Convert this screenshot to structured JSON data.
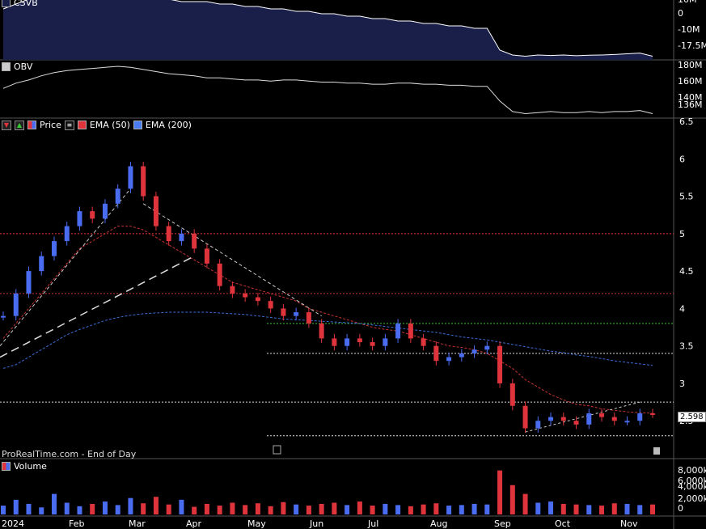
{
  "panels": {
    "csvb_label": "CSVB",
    "obv_label": "OBV",
    "price_label": "Price",
    "ema50_label": "EMA (50)",
    "ema200_label": "EMA (200)",
    "volume_label": "Volume"
  },
  "footer": "ProRealTime.com - End of Day",
  "last_price": "2.598",
  "axes": {
    "csvb_ticks": [
      "10M",
      "0",
      "-10M",
      "-17.5M"
    ],
    "obv_ticks": [
      "180M",
      "160M",
      "140M",
      "136M"
    ],
    "price_ticks": [
      "6.5",
      "6",
      "5.5",
      "5",
      "4.5",
      "4",
      "3.5",
      "3",
      "2.5"
    ],
    "volume_ticks": [
      "8,000k",
      "6,000k",
      "4,000k",
      "2,000k",
      "0"
    ],
    "x_ticks": [
      "2024",
      "Feb",
      "Mar",
      "Apr",
      "May",
      "Jun",
      "Jul",
      "Aug",
      "Sep",
      "Oct",
      "Nov"
    ]
  },
  "colors": {
    "up": "#4a6cf0",
    "down": "#e0343c",
    "ema50": "#c83232",
    "ema200": "#3c6cd8",
    "csvb_fill": "#1a1f4a"
  },
  "chart_data": {
    "type": "line",
    "x_ticks": [
      "2024",
      "Feb",
      "Mar",
      "Apr",
      "May",
      "Jun",
      "Jul",
      "Aug",
      "Sep",
      "Oct",
      "Nov"
    ],
    "price_ylim": [
      2.2,
      6.5
    ],
    "price": [
      3.9,
      4.2,
      4.5,
      4.7,
      4.9,
      5.1,
      5.3,
      5.2,
      5.4,
      5.6,
      5.9,
      5.5,
      5.1,
      4.9,
      5.0,
      4.8,
      4.6,
      4.3,
      4.2,
      4.15,
      4.1,
      4.0,
      3.9,
      3.95,
      3.8,
      3.6,
      3.5,
      3.6,
      3.55,
      3.5,
      3.6,
      3.8,
      3.6,
      3.5,
      3.3,
      3.35,
      3.4,
      3.45,
      3.5,
      3.0,
      2.7,
      2.4,
      2.5,
      2.55,
      2.5,
      2.45,
      2.6,
      2.55,
      2.5,
      2.5,
      2.6,
      2.598
    ],
    "ema50": [
      3.6,
      3.8,
      4.0,
      4.2,
      4.4,
      4.6,
      4.8,
      4.9,
      5.0,
      5.1,
      5.1,
      5.05,
      4.95,
      4.85,
      4.75,
      4.65,
      4.55,
      4.45,
      4.35,
      4.3,
      4.25,
      4.2,
      4.15,
      4.1,
      4.0,
      3.95,
      3.9,
      3.85,
      3.8,
      3.75,
      3.72,
      3.7,
      3.65,
      3.6,
      3.55,
      3.5,
      3.48,
      3.45,
      3.4,
      3.3,
      3.2,
      3.05,
      2.95,
      2.85,
      2.78,
      2.72,
      2.7,
      2.66,
      2.64,
      2.62,
      2.61,
      2.6
    ],
    "ema200": [
      3.2,
      3.25,
      3.35,
      3.45,
      3.55,
      3.65,
      3.72,
      3.78,
      3.84,
      3.88,
      3.91,
      3.93,
      3.94,
      3.95,
      3.95,
      3.95,
      3.95,
      3.94,
      3.93,
      3.92,
      3.9,
      3.88,
      3.86,
      3.85,
      3.84,
      3.83,
      3.82,
      3.81,
      3.8,
      3.78,
      3.76,
      3.74,
      3.72,
      3.7,
      3.68,
      3.65,
      3.62,
      3.6,
      3.58,
      3.55,
      3.52,
      3.49,
      3.46,
      3.43,
      3.41,
      3.38,
      3.36,
      3.33,
      3.3,
      3.28,
      3.26,
      3.24
    ],
    "horizontal_levels": [
      5.0,
      4.2,
      3.8,
      3.4,
      2.75,
      2.3
    ],
    "csvb": [
      2,
      4,
      6,
      7,
      8,
      9,
      9,
      8,
      8,
      8,
      7,
      7,
      6,
      6,
      5,
      5,
      5,
      4,
      4,
      3,
      3,
      2,
      2,
      1,
      1,
      0,
      0,
      -1,
      -1,
      -2,
      -2,
      -3,
      -3,
      -4,
      -4,
      -5,
      -5,
      -6,
      -6,
      -15,
      -17,
      -17.5,
      -17,
      -17.2,
      -17,
      -17.3,
      -17.1,
      -17,
      -16.8,
      -16.5,
      -16.2,
      -17.5
    ],
    "obv": [
      160,
      165,
      168,
      172,
      175,
      177,
      178,
      179,
      180,
      181,
      180,
      178,
      176,
      174,
      173,
      172,
      170,
      170,
      169,
      168,
      168,
      167,
      168,
      168,
      167,
      166,
      166,
      165,
      165,
      164,
      164,
      165,
      165,
      164,
      164,
      163,
      163,
      162,
      162,
      148,
      138,
      136,
      137,
      138,
      137,
      137,
      138,
      137,
      138,
      138,
      139,
      136
    ],
    "volume": [
      1.5,
      2.5,
      1.8,
      1.2,
      3.5,
      2.0,
      1.4,
      1.8,
      2.2,
      1.6,
      2.8,
      1.9,
      3.0,
      1.7,
      2.5,
      1.3,
      1.8,
      1.5,
      2.0,
      1.6,
      1.9,
      1.4,
      2.1,
      1.7,
      1.5,
      1.8,
      2.0,
      1.6,
      2.2,
      1.5,
      1.8,
      1.6,
      1.4,
      1.7,
      1.9,
      1.5,
      1.6,
      1.8,
      1.7,
      7.5,
      5.0,
      3.5,
      2.0,
      2.2,
      1.8,
      1.7,
      1.6,
      1.5,
      1.9,
      1.8,
      1.6,
      1.7
    ]
  }
}
